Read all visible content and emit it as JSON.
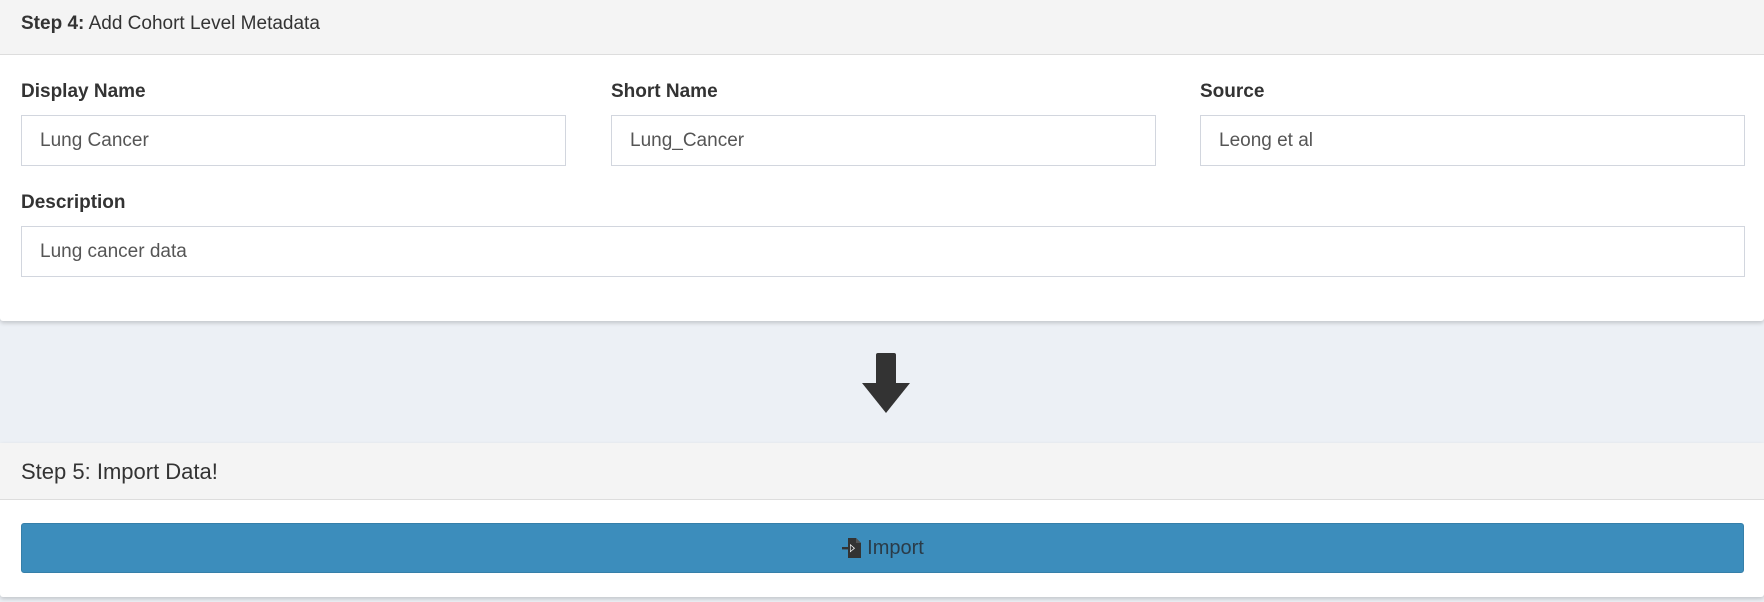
{
  "step4": {
    "header_bold": "Step 4:",
    "header_text": "Add Cohort Level Metadata",
    "display_name": {
      "label": "Display Name",
      "value": "Lung Cancer"
    },
    "short_name": {
      "label": "Short Name",
      "value": "Lung_Cancer"
    },
    "source": {
      "label": "Source",
      "value": "Leong et al"
    },
    "description": {
      "label": "Description",
      "value": "Lung cancer data"
    }
  },
  "arrow": {
    "icon": "arrow-down-icon"
  },
  "step5": {
    "header": "Step 5: Import Data!",
    "import_button": {
      "label": "Import",
      "icon": "file-import-icon",
      "color": "#3c8dbc"
    }
  }
}
